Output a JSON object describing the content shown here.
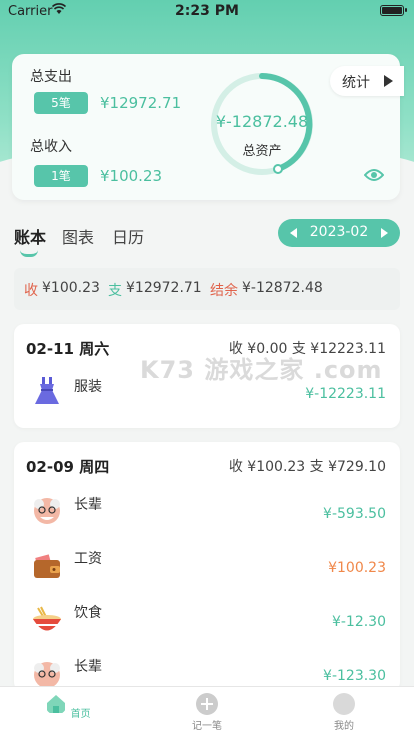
{
  "status": {
    "carrier": "Carrier",
    "time": "2:23 PM"
  },
  "summary": {
    "expense_label": "总支出",
    "expense_count": "5笔",
    "expense_amount": "¥12972.71",
    "income_label": "总收入",
    "income_count": "1笔",
    "income_amount": "¥100.23",
    "asset_value": "¥-12872.48",
    "asset_label": "总资产",
    "stats_label": "统计"
  },
  "tabs": [
    "账本",
    "图表",
    "日历"
  ],
  "month": "2023-02",
  "totals": {
    "income_label": "收",
    "income": "¥100.23",
    "expense_label": "支",
    "expense": "¥12972.71",
    "balance_label": "结余",
    "balance": "¥-12872.48"
  },
  "days": [
    {
      "date": "02-11 周六",
      "summary": "收 ¥0.00  支 ¥12223.11",
      "entries": [
        {
          "name": "服装",
          "amount": "¥-12223.11",
          "type": "expense",
          "icon": "dress-icon"
        }
      ]
    },
    {
      "date": "02-09 周四",
      "summary": "收 ¥100.23  支 ¥729.10",
      "entries": [
        {
          "name": "长辈",
          "amount": "¥-593.50",
          "type": "expense",
          "icon": "elder-icon"
        },
        {
          "name": "工资",
          "amount": "¥100.23",
          "type": "income",
          "icon": "wallet-icon"
        },
        {
          "name": "饮食",
          "amount": "¥-12.30",
          "type": "expense",
          "icon": "noodle-bowl-icon"
        },
        {
          "name": "长辈",
          "amount": "¥-123.30",
          "type": "expense",
          "icon": "elder-icon"
        }
      ]
    }
  ],
  "watermark": "K73 游戏之家 .com",
  "tabbar": [
    {
      "label": "首页",
      "icon": "home-icon"
    },
    {
      "label": "记一笔",
      "icon": "add-icon"
    },
    {
      "label": "我的",
      "icon": "profile-icon"
    }
  ],
  "colors": {
    "accent": "#57c5aa",
    "income": "#f0884a",
    "expense": "#4bbf9f",
    "red": "#e0634b"
  }
}
